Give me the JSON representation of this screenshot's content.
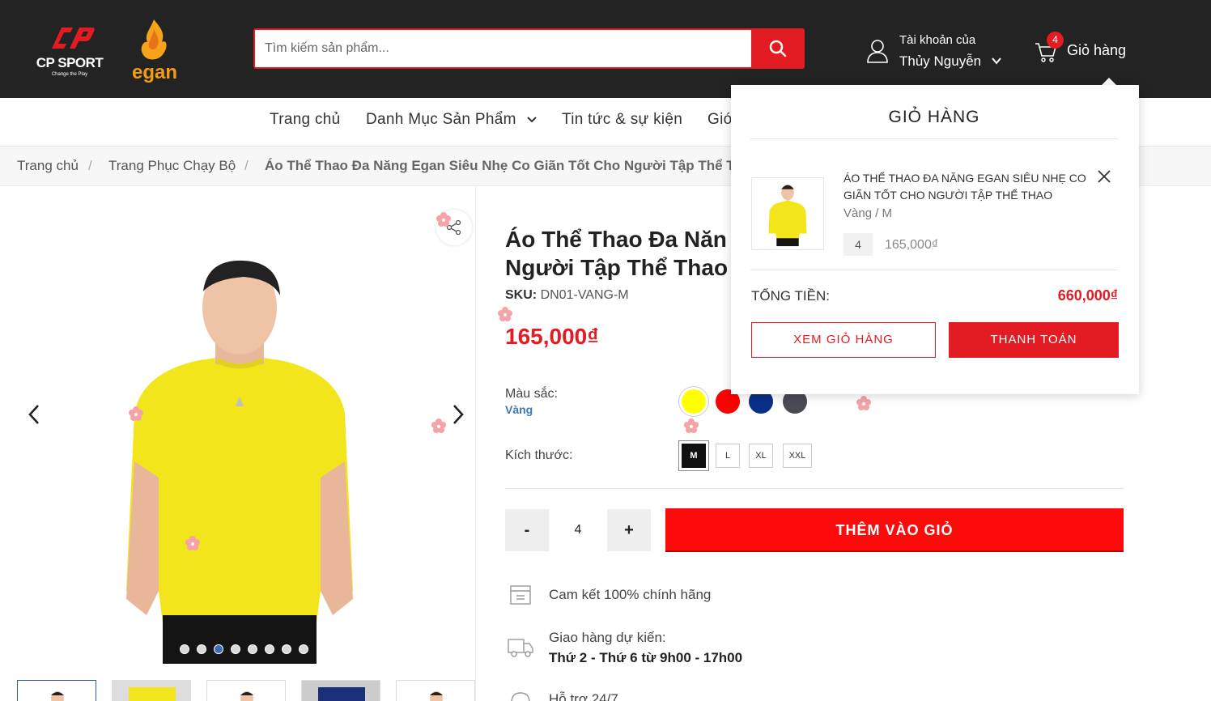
{
  "header": {
    "logo_cp": {
      "brand": "CP SPORT",
      "tagline": "Change the Play"
    },
    "logo_egan": {
      "word": "egan"
    },
    "search": {
      "placeholder": "Tìm kiếm sản phẩm..."
    },
    "account": {
      "line1": "Tài khoản của",
      "name": "Thủy Nguyễn"
    },
    "cart": {
      "count": "4",
      "label": "Giỏ hàng"
    }
  },
  "nav": {
    "items": [
      {
        "label": "Trang chủ"
      },
      {
        "label": "Danh Mục Sản Phẩm"
      },
      {
        "label": "Tin tức & sự kiện"
      },
      {
        "label": "Giớ"
      }
    ]
  },
  "breadcrumb": {
    "items": [
      {
        "label": "Trang chủ"
      },
      {
        "label": "Trang Phục Chạy Bộ"
      },
      {
        "label": "Áo Thể Thao Đa Năng Egan Siêu Nhẹ Co Giãn Tốt Cho Người Tập Thể Th"
      }
    ],
    "separator": "/"
  },
  "product": {
    "title_line1": "Áo Thể Thao Đa Năn",
    "title_line2": "Người Tập Thể Thao",
    "sku_label": "SKU:",
    "sku_value": "DN01-VANG-M",
    "price": "165,000₫",
    "color_label": "Màu sắc:",
    "color_selected": "Vàng",
    "colors": [
      "#ffff00",
      "#ff0000",
      "#0a2f8a",
      "#4a4a55"
    ],
    "size_label": "Kích thước:",
    "sizes": [
      "M",
      "L",
      "XL",
      "XXL"
    ],
    "size_selected": "M",
    "qty_minus": "-",
    "qty_value": "4",
    "qty_plus": "+",
    "add_to_cart": "THÊM VÀO GIỎ",
    "features": [
      {
        "icon": "authentic-box-icon",
        "text": "Cam kết 100% chính hãng"
      },
      {
        "icon": "delivery-truck-icon",
        "text": "Giao hàng dự kiến:",
        "bold": "Thứ 2 - Thứ 6 từ 9h00 - 17h00"
      },
      {
        "icon": "support-icon",
        "text": "Hỗ trợ 24/7"
      }
    ]
  },
  "gallery": {
    "slide_count": 8,
    "active_slide": 3,
    "thumbnail_count": 5
  },
  "cart_dropdown": {
    "title": "GIỎ HÀNG",
    "item": {
      "name": "ÁO THỂ THAO ĐA NĂNG EGAN SIÊU NHẸ CO GIÃN TỐT CHO NGƯỜI TẬP THỂ THAO",
      "variant": "Vàng / M",
      "qty": "4",
      "price": "165,000₫"
    },
    "total_label": "TỔNG TIỀN:",
    "total_value": "660,000₫",
    "view_cart": "XEM GIỎ HÀNG",
    "checkout": "THANH TOÁN"
  },
  "colors": {
    "header_bg": "#232323",
    "accent": "#e31b23",
    "add_to_cart": "#ff0a0a"
  }
}
